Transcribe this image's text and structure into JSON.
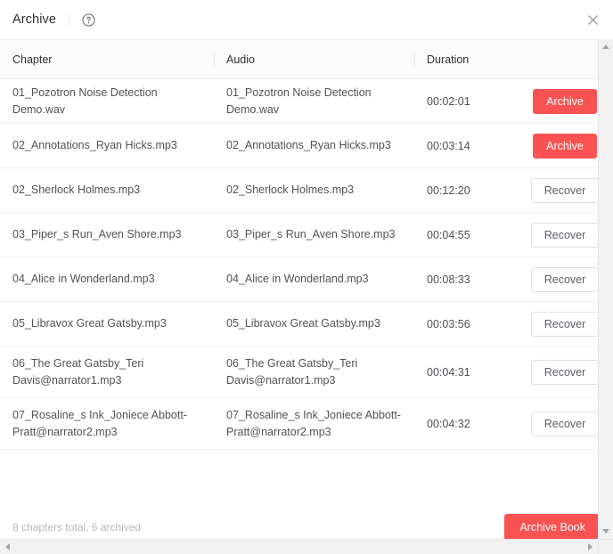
{
  "header": {
    "title": "Archive",
    "help_icon": "question-circle-icon",
    "close_icon": "close-icon"
  },
  "table": {
    "columns": [
      "Chapter",
      "Audio",
      "Duration",
      ""
    ],
    "rows": [
      {
        "chapter": "01_Pozotron Noise Detection Demo.wav",
        "audio": "01_Pozotron Noise Detection Demo.wav",
        "duration": "00:02:01",
        "action": "Archive",
        "action_state": "archive"
      },
      {
        "chapter": "02_Annotations_Ryan Hicks.mp3",
        "audio": "02_Annotations_Ryan Hicks.mp3",
        "duration": "00:03:14",
        "action": "Archive",
        "action_state": "archive"
      },
      {
        "chapter": "02_Sherlock Holmes.mp3",
        "audio": "02_Sherlock Holmes.mp3",
        "duration": "00:12:20",
        "action": "Recover",
        "action_state": "recover"
      },
      {
        "chapter": "03_Piper_s Run_Aven Shore.mp3",
        "audio": "03_Piper_s Run_Aven Shore.mp3",
        "duration": "00:04:55",
        "action": "Recover",
        "action_state": "recover"
      },
      {
        "chapter": "04_Alice in Wonderland.mp3",
        "audio": "04_Alice in Wonderland.mp3",
        "duration": "00:08:33",
        "action": "Recover",
        "action_state": "recover"
      },
      {
        "chapter": "05_Libravox Great Gatsby.mp3",
        "audio": "05_Libravox Great Gatsby.mp3",
        "duration": "00:03:56",
        "action": "Recover",
        "action_state": "recover"
      },
      {
        "chapter": "06_The Great Gatsby_Teri Davis@narrator1.mp3",
        "audio": "06_The Great Gatsby_Teri Davis@narrator1.mp3",
        "duration": "00:04:31",
        "action": "Recover",
        "action_state": "recover"
      },
      {
        "chapter": "07_Rosaline_s Ink_Joniece Abbott-Pratt@narrator2.mp3",
        "audio": "07_Rosaline_s Ink_Joniece Abbott-Pratt@narrator2.mp3",
        "duration": "00:04:32",
        "action": "Recover",
        "action_state": "recover"
      }
    ]
  },
  "footer": {
    "status": "8 chapters total, 6 archived",
    "archive_book_label": "Archive Book"
  },
  "colors": {
    "accent_red": "#fa5252",
    "header_bg": "#fafafa",
    "border": "#ebeef5",
    "text": "#303133",
    "muted_text": "#b4b7bd"
  },
  "scrollbars": {
    "vertical": "vertical-scrollbar",
    "horizontal": "horizontal-scrollbar"
  }
}
